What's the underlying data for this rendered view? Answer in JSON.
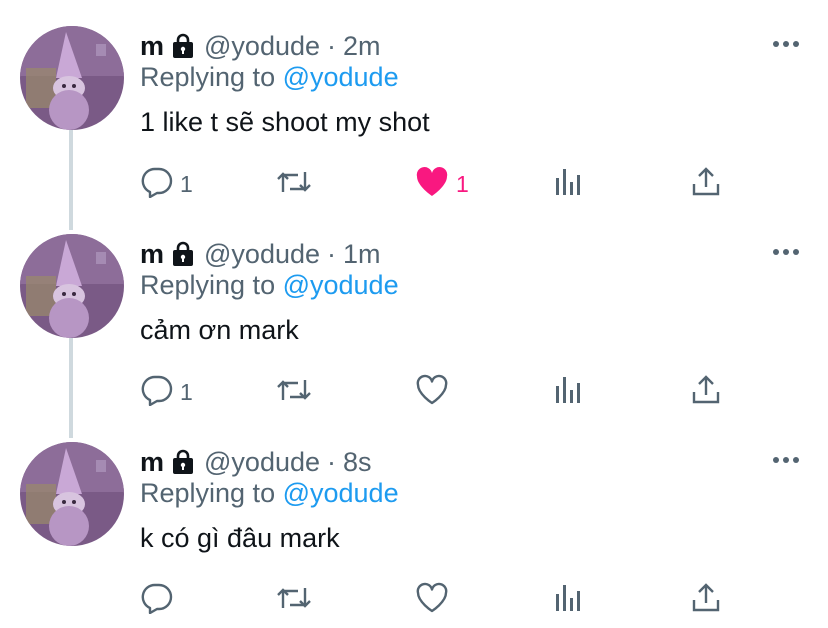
{
  "tweets": [
    {
      "name": "m",
      "handle": "@yodude",
      "separator": "·",
      "time": "2m",
      "replying_prefix": "Replying to ",
      "replying_to": "@yodude",
      "text": "1 like t sẽ shoot my shot",
      "reply_count": "1",
      "retweet_count": "",
      "like_count": "1",
      "liked": true
    },
    {
      "name": "m",
      "handle": "@yodude",
      "separator": "·",
      "time": "1m",
      "replying_prefix": "Replying to ",
      "replying_to": "@yodude",
      "text": "cảm ơn mark",
      "reply_count": "1",
      "retweet_count": "",
      "like_count": "",
      "liked": false
    },
    {
      "name": "m",
      "handle": "@yodude",
      "separator": "·",
      "time": "8s",
      "replying_prefix": "Replying to ",
      "replying_to": "@yodude",
      "text": "k có gì đâu mark",
      "reply_count": "",
      "retweet_count": "",
      "like_count": "",
      "liked": false
    }
  ],
  "icons": {
    "verified_lock": "lock-icon",
    "more": "more-icon",
    "reply": "reply-icon",
    "retweet": "retweet-icon",
    "like": "heart-icon",
    "stats": "stats-icon",
    "share": "share-icon"
  },
  "colors": {
    "mention": "#1d9bf0",
    "secondary_text": "#536471",
    "like_active": "#f91880",
    "thread_line": "#cfd9de"
  }
}
